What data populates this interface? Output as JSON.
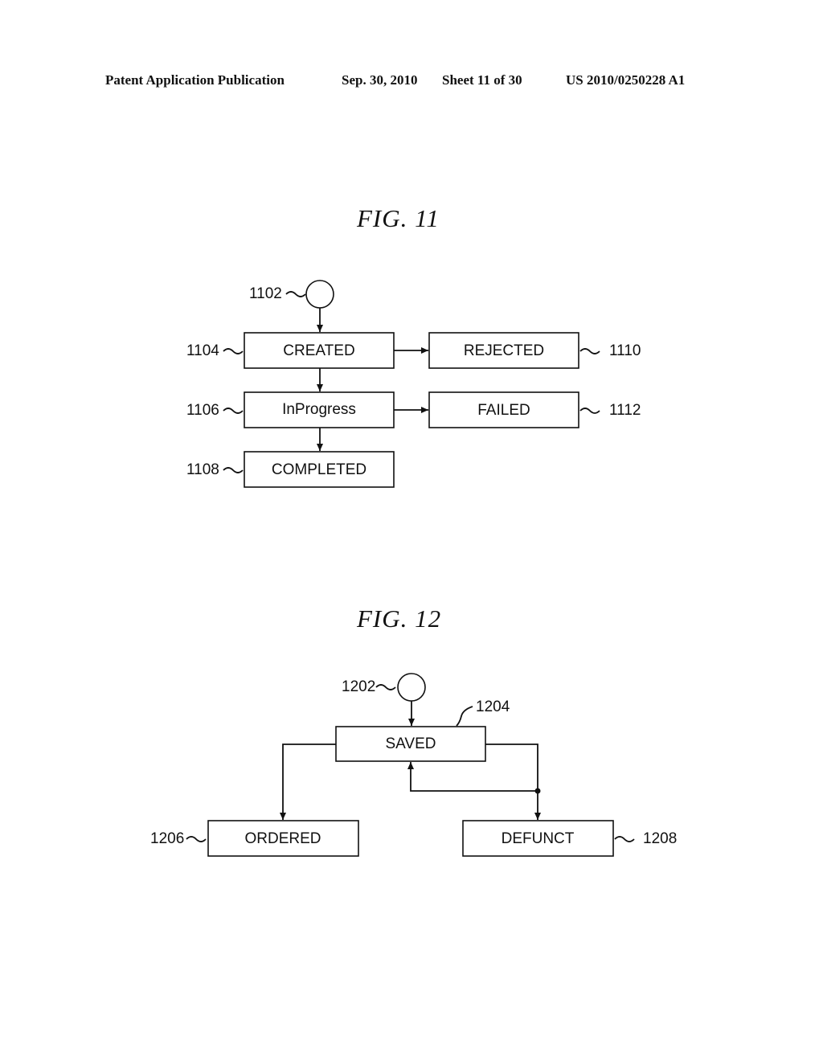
{
  "header": {
    "publication": "Patent Application Publication",
    "date": "Sep. 30, 2010",
    "sheet": "Sheet 11 of 30",
    "number": "US 2010/0250228 A1"
  },
  "figures": [
    {
      "title": "FIG.  11",
      "start_ref": "1102",
      "states": [
        {
          "id": "created",
          "label": "CREATED",
          "ref": "1104"
        },
        {
          "id": "inprogress",
          "label": "InProgress",
          "ref": "1106"
        },
        {
          "id": "completed",
          "label": "COMPLETED",
          "ref": "1108"
        },
        {
          "id": "rejected",
          "label": "REJECTED",
          "ref": "1110"
        },
        {
          "id": "failed",
          "label": "FAILED",
          "ref": "1112"
        }
      ],
      "transitions": [
        [
          "start",
          "created"
        ],
        [
          "created",
          "inprogress"
        ],
        [
          "inprogress",
          "completed"
        ],
        [
          "created",
          "rejected"
        ],
        [
          "inprogress",
          "failed"
        ]
      ]
    },
    {
      "title": "FIG.  12",
      "start_ref": "1202",
      "states": [
        {
          "id": "saved",
          "label": "SAVED",
          "ref": "1204"
        },
        {
          "id": "ordered",
          "label": "ORDERED",
          "ref": "1206"
        },
        {
          "id": "defunct",
          "label": "DEFUNCT",
          "ref": "1208"
        }
      ],
      "transitions": [
        [
          "start",
          "saved"
        ],
        [
          "saved",
          "ordered"
        ],
        [
          "saved",
          "defunct"
        ],
        [
          "saved",
          "saved"
        ]
      ]
    }
  ]
}
